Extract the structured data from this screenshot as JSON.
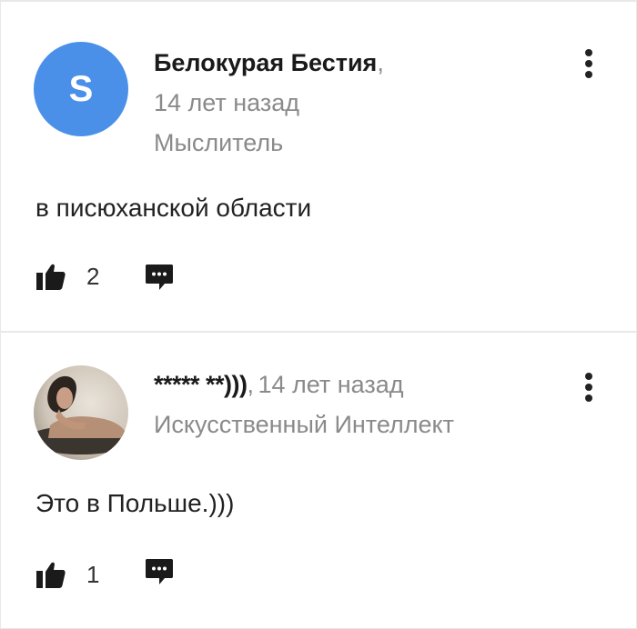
{
  "comments": [
    {
      "avatar_letter": "S",
      "avatar_color": "#4a90e8",
      "author": "Белокурая Бестия",
      "separator": ",",
      "time": "14 лет назад",
      "rank": "Мыслитель",
      "text": "в писюханской области",
      "likes": "2",
      "icons": {
        "like": "thumbs-up-icon",
        "reply": "comment-bubble-icon",
        "menu": "more-vertical-icon"
      }
    },
    {
      "avatar_kind": "photo",
      "author": "***** **)))",
      "separator": ",",
      "time": "14 лет назад",
      "rank": "Искусственный Интеллект",
      "text": "Это в Польше.)))",
      "likes": "1",
      "icons": {
        "like": "thumbs-up-icon",
        "reply": "comment-bubble-icon",
        "menu": "more-vertical-icon"
      }
    }
  ]
}
